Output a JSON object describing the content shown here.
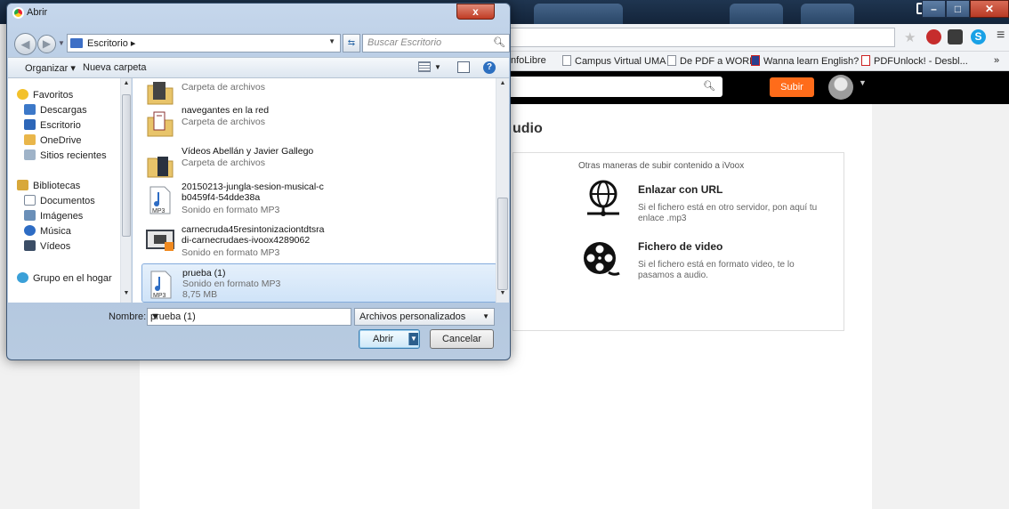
{
  "dialog": {
    "title": "Abrir",
    "close_symbol": "x",
    "address": {
      "path": "Escritorio",
      "separator": "▸"
    },
    "search_placeholder": "Buscar Escritorio",
    "toolbar": {
      "organize": "Organizar ▾",
      "new_folder": "Nueva carpeta"
    },
    "nav_groups": [
      {
        "label": "Favoritos",
        "icon": "star-icon",
        "children": [
          "Descargas",
          "Escritorio",
          "OneDrive",
          "Sitios recientes"
        ]
      },
      {
        "label": "Bibliotecas",
        "icon": "library-icon",
        "children": [
          "Documentos",
          "Imágenes",
          "Música",
          "Vídeos"
        ]
      },
      {
        "label": "Grupo en el hogar",
        "icon": "homegroup-icon",
        "children": []
      }
    ],
    "files": [
      {
        "name": "",
        "type": "Carpeta de archivos",
        "size": "",
        "icon": "folder-icon"
      },
      {
        "name": "navegantes en la red",
        "type": "Carpeta de archivos",
        "size": "",
        "icon": "folder-icon"
      },
      {
        "name": "Vídeos Abellán y Javier Gallego",
        "type": "Carpeta de archivos",
        "size": "",
        "icon": "folder-icon"
      },
      {
        "name": "20150213-jungla-sesion-musical-c b0459f4-54dde38a",
        "type": "Sonido en formato MP3",
        "size": "",
        "icon": "mp3-file-icon"
      },
      {
        "name": "carnecruda45resintonizaciontdtsra di-carnecrudaes-ivoox4289062",
        "type": "Sonido en formato MP3",
        "size": "",
        "icon": "media-file-icon"
      },
      {
        "name": "prueba (1)",
        "type": "Sonido en formato MP3",
        "size": "8,75 MB",
        "icon": "mp3-file-icon",
        "selected": true
      }
    ],
    "mp3_tag": "MP3",
    "filename_label": "Nombre:",
    "filename_value": "prueba (1)",
    "filetype_value": "Archivos personalizados",
    "open_label": "Abrir",
    "cancel_label": "Cancelar"
  },
  "browser": {
    "bookmarks": [
      "nfoLibre",
      "Campus Virtual UMA",
      "De PDF a WORD",
      "Wanna learn English?",
      "PDFUnlock! - Desbl..."
    ],
    "bookmarks_more": "»",
    "ext_skype_letter": "S",
    "menu_symbol": "≡"
  },
  "site": {
    "upload_button": "Subir",
    "heading": "udio",
    "other_ways": "Otras maneras de subir contenido a iVoox",
    "options": [
      {
        "title": "Enlazar con URL",
        "desc": "Si el fichero está en otro servidor, pon aquí tu enlace .mp3",
        "icon": "globe-link-icon"
      },
      {
        "title": "Fichero de video",
        "desc": "Si el fichero está en formato video, te lo pasamos a audio.",
        "icon": "film-reel-icon"
      }
    ]
  },
  "colors": {
    "accent_orange": "#ff6c1a",
    "selection_blue": "#cfe3f8",
    "dialog_frame": "#aac1db"
  }
}
